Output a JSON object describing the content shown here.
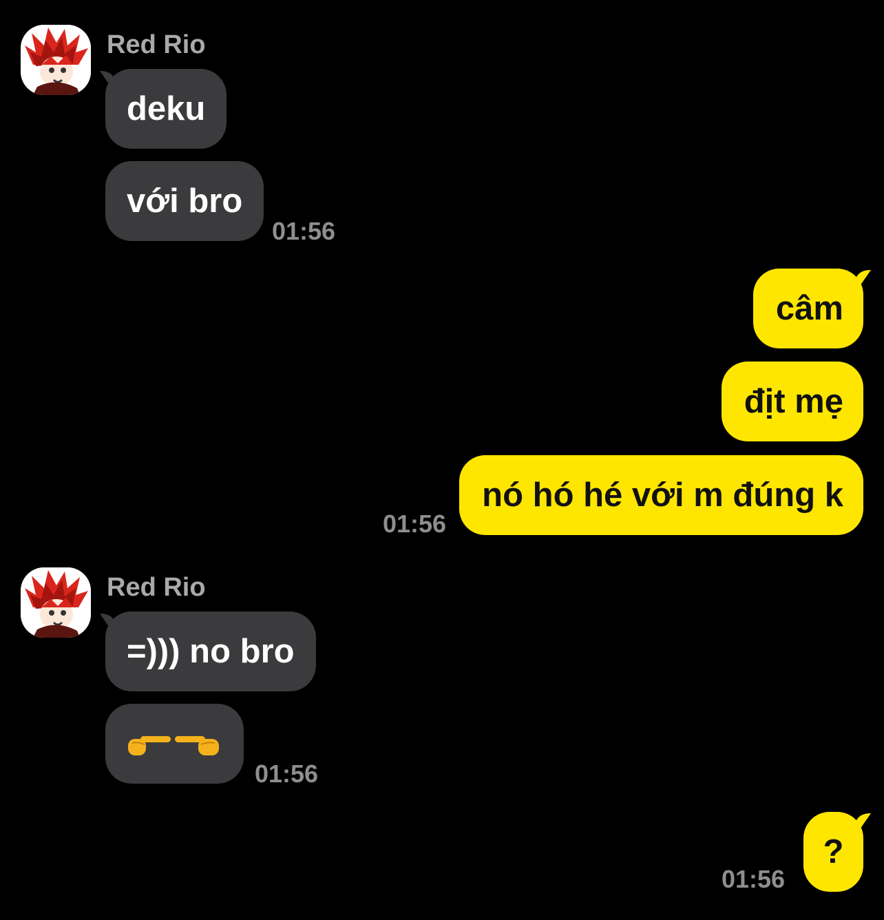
{
  "theme": {
    "background": "#000000",
    "incoming_bubble": "#3b3b3d",
    "outgoing_bubble": "#ffe600",
    "sender_name_color": "#a9a9a9",
    "timestamp_color": "#8e8e8e"
  },
  "groups": [
    {
      "direction": "incoming",
      "sender": "Red Rio",
      "avatar_icon": "red-hair-anime-avatar",
      "messages": [
        "deku",
        "với bro"
      ],
      "time": "01:56"
    },
    {
      "direction": "outgoing",
      "messages": [
        "câm",
        "địt mẹ",
        "nó hó hé với m đúng k"
      ],
      "time": "01:56"
    },
    {
      "direction": "incoming",
      "sender": "Red Rio",
      "avatar_icon": "red-hair-anime-avatar",
      "messages": [
        "=))) no bro",
        "👉👈"
      ],
      "time": "01:56"
    },
    {
      "direction": "outgoing",
      "messages": [
        "?"
      ],
      "time": "01:56"
    }
  ]
}
